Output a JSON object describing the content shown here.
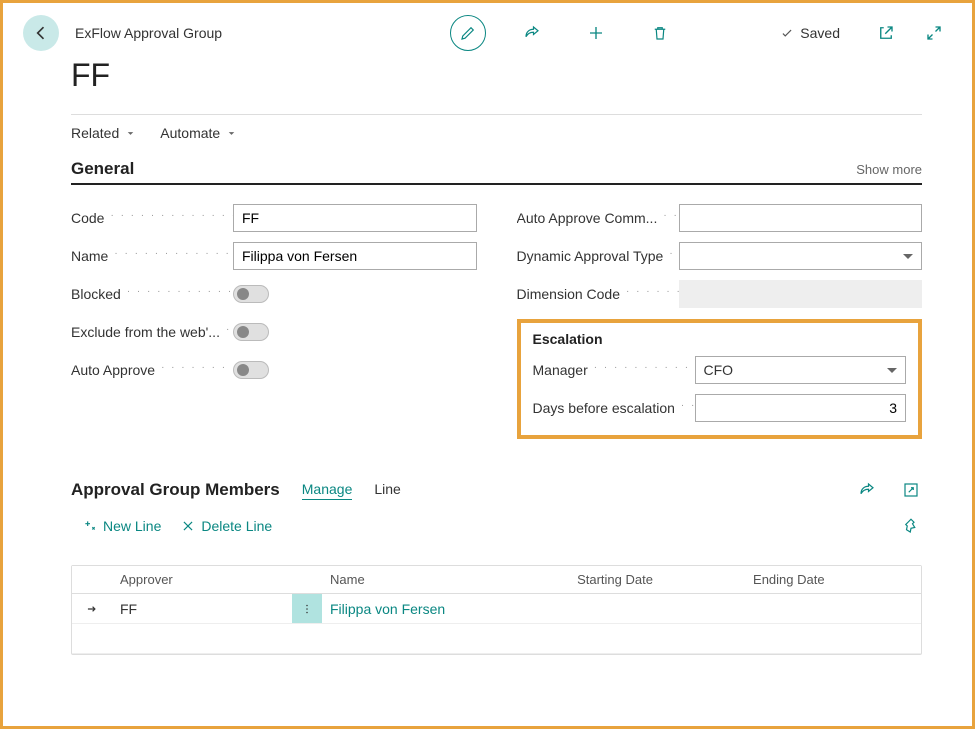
{
  "header": {
    "breadcrumb": "ExFlow Approval Group",
    "saved_label": "Saved"
  },
  "page_title": "FF",
  "menu": {
    "related": "Related",
    "automate": "Automate"
  },
  "general": {
    "title": "General",
    "show_more": "Show more",
    "labels": {
      "code": "Code",
      "name": "Name",
      "blocked": "Blocked",
      "exclude": "Exclude from the web'...",
      "auto_approve": "Auto Approve",
      "auto_approve_comm": "Auto Approve Comm...",
      "dyn_approval_type": "Dynamic Approval Type",
      "dimension_code": "Dimension Code"
    },
    "values": {
      "code": "FF",
      "name": "Filippa von Fersen",
      "blocked": false,
      "exclude": false,
      "auto_approve": false,
      "auto_approve_comm": "",
      "dyn_approval_type": "",
      "dimension_code": ""
    }
  },
  "escalation": {
    "title": "Escalation",
    "labels": {
      "manager": "Manager",
      "days": "Days before escalation"
    },
    "values": {
      "manager": "CFO",
      "days": "3"
    }
  },
  "members": {
    "title": "Approval Group Members",
    "tabs": {
      "manage": "Manage",
      "line": "Line"
    },
    "toolbar": {
      "new_line": "New Line",
      "delete_line": "Delete Line"
    },
    "columns": [
      "Approver",
      "Name",
      "Starting Date",
      "Ending Date"
    ],
    "rows": [
      {
        "approver": "FF",
        "name": "Filippa von Fersen",
        "start": "",
        "end": ""
      }
    ]
  }
}
